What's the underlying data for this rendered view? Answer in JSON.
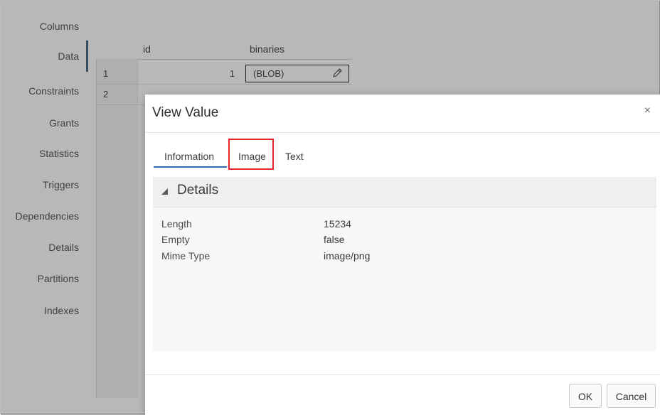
{
  "left_nav": {
    "items": [
      {
        "label": "Columns"
      },
      {
        "label": "Data",
        "active": true
      },
      {
        "label": "Constraints"
      },
      {
        "label": "Grants"
      },
      {
        "label": "Statistics"
      },
      {
        "label": "Triggers"
      },
      {
        "label": "Dependencies"
      },
      {
        "label": "Details"
      },
      {
        "label": "Partitions"
      },
      {
        "label": "Indexes"
      }
    ]
  },
  "grid": {
    "columns": [
      "id",
      "binaries"
    ],
    "rows": [
      {
        "row_number": "1",
        "id": "1",
        "binaries": "(BLOB)"
      },
      {
        "row_number": "2",
        "id": "",
        "binaries": ""
      }
    ]
  },
  "dialog": {
    "title": "View Value",
    "close_glyph": "×",
    "tabs": [
      {
        "label": "Information",
        "selected": true
      },
      {
        "label": "Image",
        "highlighted": true
      },
      {
        "label": "Text"
      }
    ],
    "section_title": "Details",
    "fields": [
      {
        "label": "Length",
        "value": "15234"
      },
      {
        "label": "Empty",
        "value": "false"
      },
      {
        "label": "Mime Type",
        "value": "image/png"
      }
    ],
    "buttons": {
      "ok": "OK",
      "cancel": "Cancel"
    }
  },
  "colors": {
    "active_indicator": "#4a6e85",
    "tab_underline": "#2a6cad",
    "highlight_box": "#e3262b"
  }
}
